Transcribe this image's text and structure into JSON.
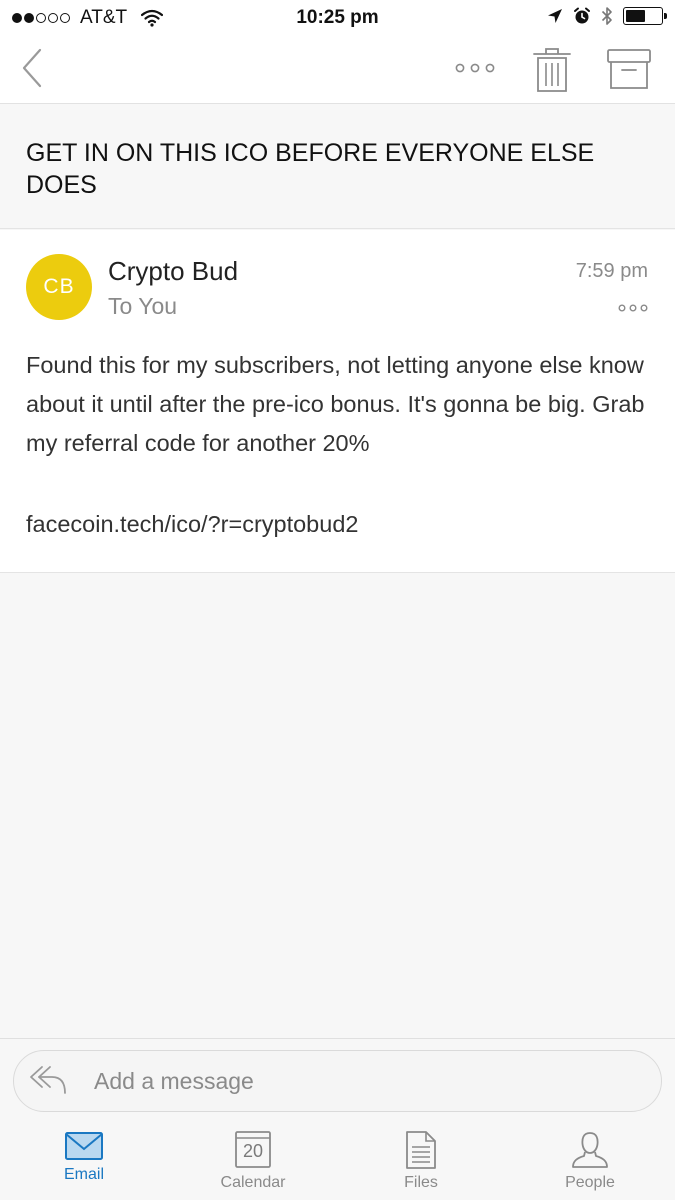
{
  "status_bar": {
    "carrier": "AT&T",
    "time": "10:25 pm",
    "signal_bars_filled": 2,
    "signal_bars_total": 5,
    "battery_level": 0.55
  },
  "nav": {
    "back_icon": "chevron-left-icon",
    "more_icon": "ellipsis-icon",
    "delete_icon": "trash-icon",
    "archive_icon": "archive-icon"
  },
  "email": {
    "subject": "GET IN ON THIS ICO BEFORE EVERYONE ELSE DOES",
    "sender_initials": "CB",
    "sender_name": "Crypto Bud",
    "recipient": "To You",
    "time": "7:59 pm",
    "body": "Found this for my subscribers, not letting anyone else know about it until after the pre-ico bonus. It's gonna be big. Grab my referral code for another 20%",
    "link": "facecoin.tech/ico/?r=cryptobud2"
  },
  "reply": {
    "placeholder": "Add a message"
  },
  "tabs": [
    {
      "label": "Email",
      "icon": "mail-icon",
      "active": true
    },
    {
      "label": "Calendar",
      "icon": "calendar-icon",
      "day": "20",
      "active": false
    },
    {
      "label": "Files",
      "icon": "file-icon",
      "active": false
    },
    {
      "label": "People",
      "icon": "person-icon",
      "active": false
    }
  ],
  "colors": {
    "accent": "#1a78c2",
    "avatar": "#eccc0e",
    "muted_text": "#8a8a8a"
  }
}
